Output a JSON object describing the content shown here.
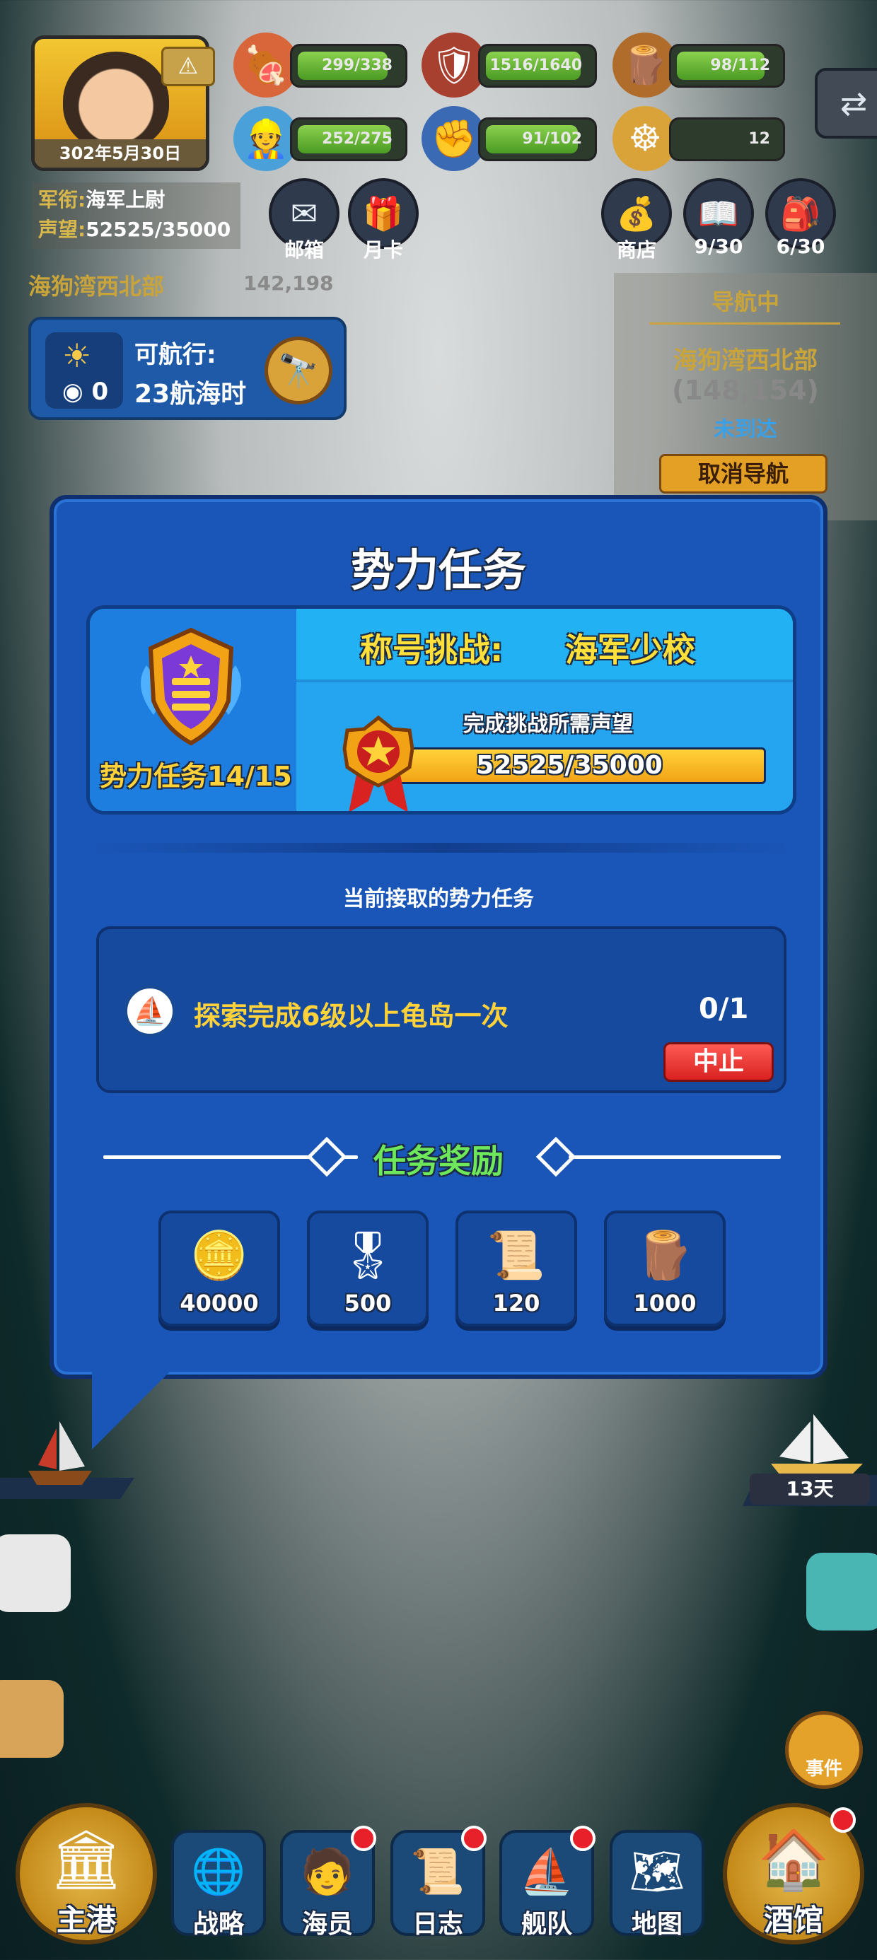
{
  "hud": {
    "date": "302年5月30日",
    "rank_label": "军衔:",
    "rank_value": "海军上尉",
    "prestige_label": "声望:",
    "prestige_value": "52525/35000",
    "resources": [
      {
        "icon": "meat-icon",
        "value": "299/338",
        "fill": 0.88
      },
      {
        "icon": "shield-icon",
        "value": "1516/1640",
        "fill": 0.92
      },
      {
        "icon": "lumber-icon",
        "value": "98/112",
        "fill": 0.87
      },
      {
        "icon": "sailor-icon",
        "value": "252/275",
        "fill": 0.92
      },
      {
        "icon": "fist-icon",
        "value": "91/102",
        "fill": 0.89
      },
      {
        "icon": "helm-icon",
        "value": "12",
        "fill": 0
      }
    ],
    "mail_label": "邮箱",
    "monthly_card_label": "月卡",
    "shop_label": "商店",
    "book_label": "9/30",
    "bag_label": "6/30"
  },
  "location": {
    "name": "海狗湾西北部",
    "coords": "142,198"
  },
  "sail": {
    "label": "可航行:",
    "hours": "23航海时",
    "count": "0"
  },
  "navigation": {
    "title": "导航中",
    "destination": "海狗湾西北部",
    "coords": "(148,154)",
    "status": "未到达",
    "cancel_label": "取消导航"
  },
  "modal": {
    "title": "势力任务",
    "challenge_label": "称号挑战:",
    "challenge_value": "海军少校",
    "task_progress": "势力任务14/15",
    "requirement_label": "完成挑战所需声望",
    "prestige_progress": "52525/35000",
    "prestige_fill": 1.0,
    "current_label": "当前接取的势力任务",
    "task_text": "探索完成6级以上龟岛一次",
    "task_count": "0/1",
    "abort_label": "中止",
    "reward_title": "任务奖励",
    "rewards": [
      {
        "icon": "gold-coin-icon",
        "amount": "40000"
      },
      {
        "icon": "medal-icon",
        "amount": "500"
      },
      {
        "icon": "scroll-icon",
        "amount": "120"
      },
      {
        "icon": "wood-icon",
        "amount": "1000"
      }
    ]
  },
  "world": {
    "days_label": "13天",
    "event_label": "事件"
  },
  "bottom_nav": [
    {
      "label": "主港",
      "icon": "port-icon"
    },
    {
      "label": "战略",
      "icon": "globe-icon"
    },
    {
      "label": "海员",
      "icon": "crew-icon"
    },
    {
      "label": "日志",
      "icon": "log-icon"
    },
    {
      "label": "舰队",
      "icon": "fleet-icon"
    },
    {
      "label": "地图",
      "icon": "map-icon"
    },
    {
      "label": "酒馆",
      "icon": "tavern-icon"
    }
  ],
  "colors": {
    "modal_bg": "#1a56b8",
    "accent_yellow": "#ffd23a",
    "reward_green": "#6ee85a",
    "abort_red": "#d82320"
  }
}
